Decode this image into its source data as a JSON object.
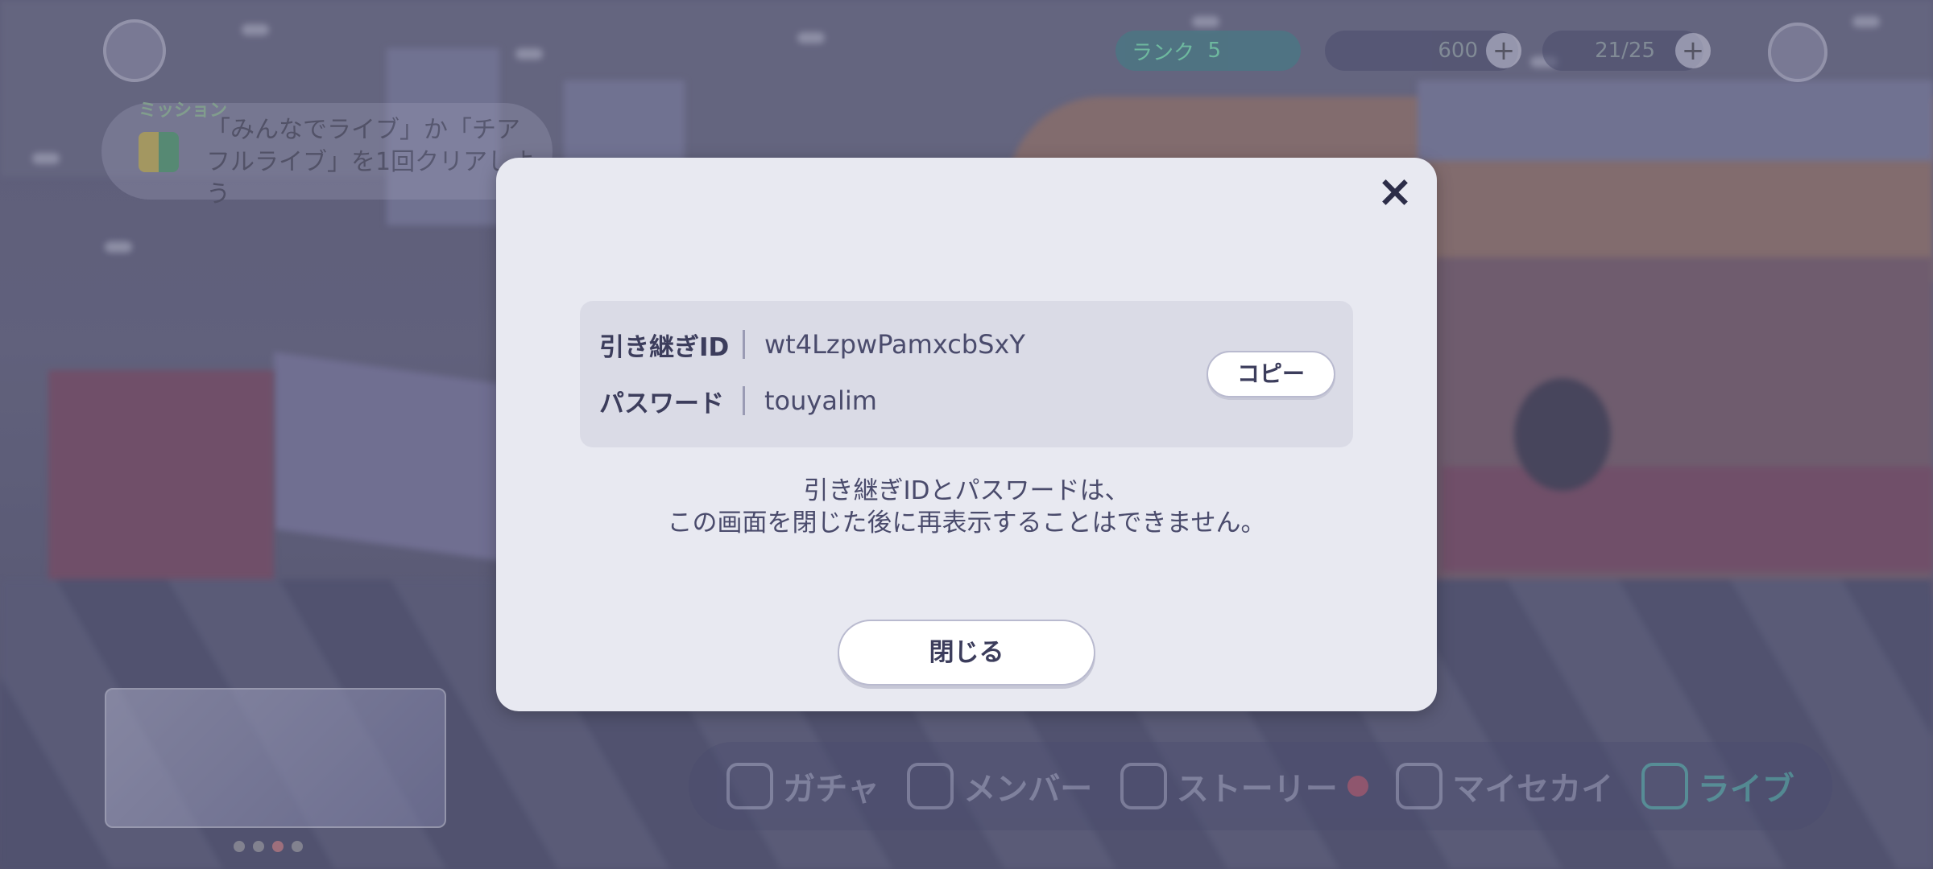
{
  "hud": {
    "rank_label": "ランク",
    "rank_value": "5",
    "crystal_value": "600",
    "energy_value": "21/25",
    "mission_tag": "ミッション",
    "mission_text": "「みんなでライブ」か「チアフルライブ」を1回クリアしよう",
    "mission_ellipsis": "・"
  },
  "bottom_nav": {
    "items": [
      {
        "label": "ガチャ",
        "icon": "gacha-icon"
      },
      {
        "label": "メンバー",
        "icon": "member-icon"
      },
      {
        "label": "ストーリー",
        "icon": "story-book-icon"
      },
      {
        "label": "マイセカイ",
        "icon": "house-icon"
      },
      {
        "label": "ライブ",
        "icon": "music-note-icon"
      }
    ]
  },
  "modal": {
    "close_icon": "×",
    "id_label": "引き継ぎID",
    "id_value": "wt4LzpwPamxcbSxY",
    "password_label": "パスワード",
    "password_value": "touyalim",
    "copy_button": "コピー",
    "notice_line1": "引き継ぎIDとパスワードは、",
    "notice_line2": "この画面を閉じた後に再表示することはできません。",
    "close_button": "閉じる"
  }
}
